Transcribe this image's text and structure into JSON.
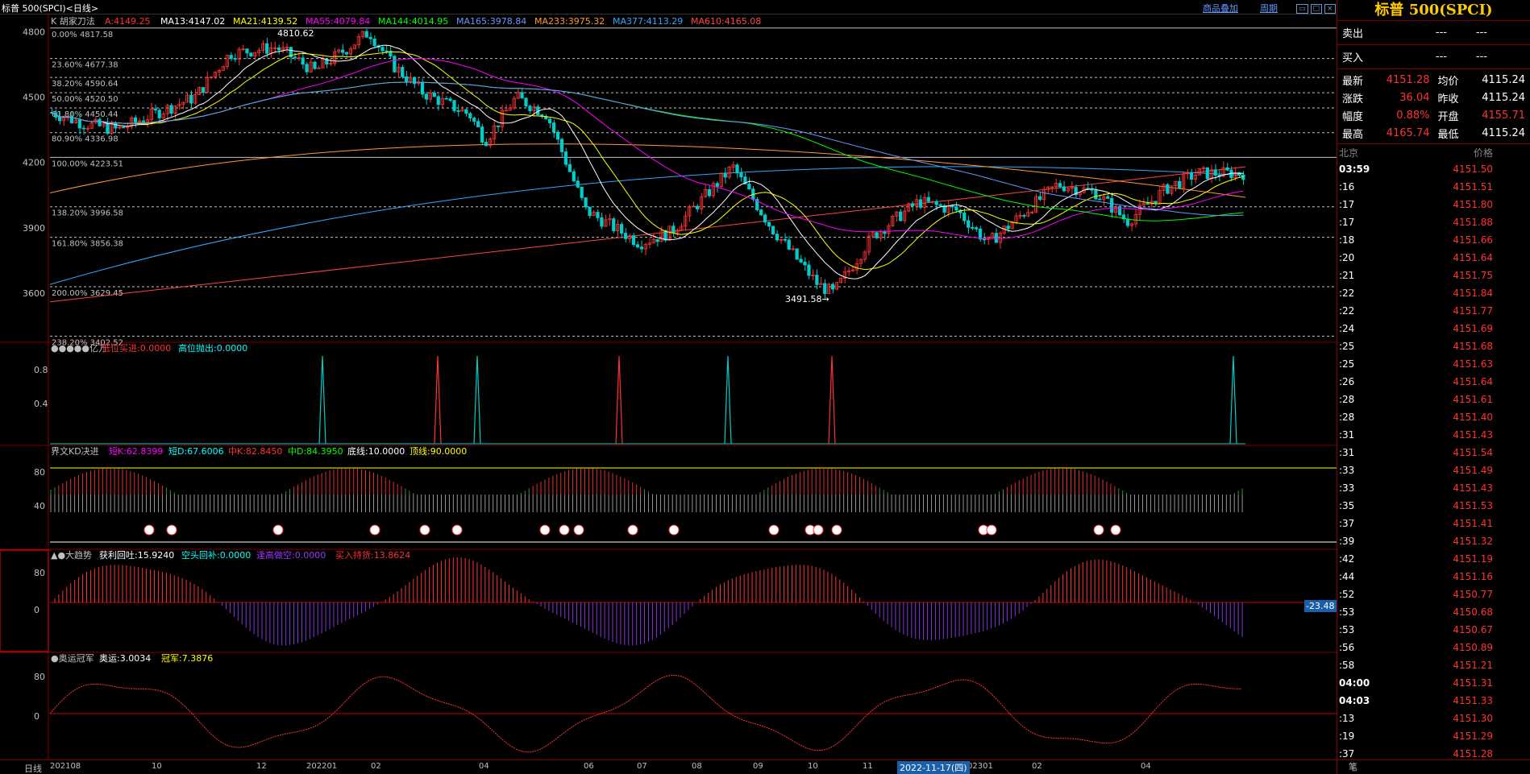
{
  "window": {
    "title": "标普 500(SPCI)<日线>",
    "menu_goods": "商品叠加",
    "menu_period": "周期"
  },
  "main": {
    "indicator_label": "K 胡家刀法",
    "ma": [
      {
        "text": "A:4149.25",
        "color": "#ff3232"
      },
      {
        "text": "MA13:4147.02",
        "color": "#ffffff"
      },
      {
        "text": "MA21:4139.52",
        "color": "#ffff00"
      },
      {
        "text": "MA55:4079.84",
        "color": "#ff00ff"
      },
      {
        "text": "MA144:4014.95",
        "color": "#00ff00"
      },
      {
        "text": "MA165:3978.84",
        "color": "#6699ff"
      },
      {
        "text": "MA233:3975.32",
        "color": "#ff9933"
      },
      {
        "text": "MA377:4113.29",
        "color": "#33aaff"
      },
      {
        "text": "MA610:4165.08",
        "color": "#ff4444"
      }
    ],
    "yticks": [
      "4800",
      "4500",
      "4200",
      "3900",
      "3600"
    ],
    "fib": [
      "0.00% 4817.58",
      "23.60% 4677.38",
      "38.20% 4590.64",
      "50.00% 4520.50",
      "61.80% 4450.44",
      "80.90% 4336.98",
      "100.00% 4223.51",
      "138.20% 3996.58",
      "161.80% 3856.38",
      "200.00% 3629.45",
      "238.20% 3402.52"
    ],
    "high_label": "4810.62",
    "low_label": "3491.58→"
  },
  "p2": {
    "title": "●●●●●亿万",
    "low_buy": "低位买进:0.0000",
    "high_sell": "高位抛出:0.0000",
    "yticks": [
      "0.8",
      "0.4"
    ]
  },
  "p3": {
    "title": "界文KD决进",
    "k_short": "短K:62.8399",
    "d_short": "短D:67.6006",
    "k_mid": "中K:82.8450",
    "d_mid": "中D:84.3950",
    "bottom": "底线:10.0000",
    "top": "顶线:90.0000",
    "yticks": [
      "80",
      "40"
    ]
  },
  "p4": {
    "title": "▲●大趋势",
    "profit": "获利回吐:15.9240",
    "short_cover": "空头回补:0.0000",
    "short_sell": "逢高做空:0.0000",
    "buy_hold": "买入持货:13.8624",
    "yticks": [
      "80",
      "0"
    ],
    "value_tag": "-23.48"
  },
  "p5": {
    "title": "●奥运冠军",
    "ao": "奥运:3.0034",
    "champ": "冠军:7.3876",
    "yticks": [
      "80",
      "0"
    ]
  },
  "xaxis": {
    "mode": "日线",
    "labels": [
      "202108",
      "10",
      "12",
      "202201",
      "02",
      "04",
      "06",
      "07",
      "08",
      "09",
      "10",
      "11",
      "02301",
      "02",
      "04"
    ],
    "cursor": "2022-11-17(四)"
  },
  "quote": {
    "title": "标普 500(SPCI)",
    "sell_label": "卖出",
    "sell_val": "---",
    "sell_vol": "---",
    "buy_label": "买入",
    "buy_val": "---",
    "buy_vol": "---",
    "rows": [
      {
        "l1": "最新",
        "v1": "4151.28",
        "l2": "均价",
        "v2": "4115.24"
      },
      {
        "l1": "涨跌",
        "v1": "36.04",
        "l2": "昨收",
        "v2": "4115.24"
      },
      {
        "l1": "幅度",
        "v1": "0.88%",
        "l2": "开盘",
        "v2": "4155.71"
      },
      {
        "l1": "最高",
        "v1": "4165.74",
        "l2": "最低",
        "v2": "4115.24"
      }
    ],
    "ticks_hdr_l": "北京",
    "ticks_hdr_r": "价格",
    "ticks": [
      {
        "t": "03:59",
        "p": "4151.50"
      },
      {
        "t": ":16",
        "p": "4151.51"
      },
      {
        "t": ":17",
        "p": "4151.80"
      },
      {
        "t": ":17",
        "p": "4151.88"
      },
      {
        "t": ":18",
        "p": "4151.66"
      },
      {
        "t": ":20",
        "p": "4151.64"
      },
      {
        "t": ":21",
        "p": "4151.75"
      },
      {
        "t": ":22",
        "p": "4151.84"
      },
      {
        "t": ":22",
        "p": "4151.77"
      },
      {
        "t": ":24",
        "p": "4151.69"
      },
      {
        "t": ":25",
        "p": "4151.68"
      },
      {
        "t": ":25",
        "p": "4151.63"
      },
      {
        "t": ":26",
        "p": "4151.64"
      },
      {
        "t": ":28",
        "p": "4151.61"
      },
      {
        "t": ":28",
        "p": "4151.40"
      },
      {
        "t": ":31",
        "p": "4151.43"
      },
      {
        "t": ":31",
        "p": "4151.54"
      },
      {
        "t": ":33",
        "p": "4151.49"
      },
      {
        "t": ":33",
        "p": "4151.43"
      },
      {
        "t": ":35",
        "p": "4151.53"
      },
      {
        "t": ":37",
        "p": "4151.41"
      },
      {
        "t": ":39",
        "p": "4151.32"
      },
      {
        "t": ":42",
        "p": "4151.19"
      },
      {
        "t": ":44",
        "p": "4151.16"
      },
      {
        "t": ":52",
        "p": "4150.77"
      },
      {
        "t": ":53",
        "p": "4150.68"
      },
      {
        "t": ":53",
        "p": "4150.67"
      },
      {
        "t": ":56",
        "p": "4150.89"
      },
      {
        "t": ":58",
        "p": "4151.21"
      },
      {
        "t": "04:00",
        "p": "4151.31"
      },
      {
        "t": "04:03",
        "p": "4151.33"
      },
      {
        "t": ":13",
        "p": "4151.30"
      },
      {
        "t": ":19",
        "p": "4151.29"
      },
      {
        "t": ":37",
        "p": "4151.28"
      }
    ],
    "footer": "笔"
  },
  "chart_data": {
    "type": "line",
    "title": "标普 500(SPCI)<日线>",
    "x": [
      "202108",
      "10",
      "12",
      "202201",
      "02",
      "04",
      "06",
      "07",
      "08",
      "09",
      "10",
      "11",
      "02301",
      "02",
      "04"
    ],
    "ylim": [
      3400,
      4850
    ],
    "series": [
      {
        "name": "K",
        "values": [
          4450,
          4400,
          4650,
          4790,
          4450,
          4560,
          3900,
          3820,
          4280,
          3640,
          3580,
          4000,
          3850,
          4150,
          4151
        ]
      }
    ]
  }
}
